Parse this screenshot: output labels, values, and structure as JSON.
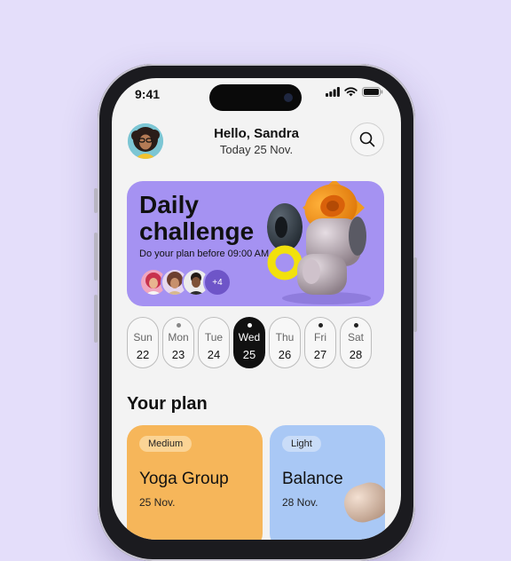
{
  "status_bar": {
    "time": "9:41"
  },
  "header": {
    "greeting": "Hello, Sandra",
    "date": "Today 25 Nov."
  },
  "challenge": {
    "title_line1": "Daily",
    "title_line2": "challenge",
    "subtitle": "Do your plan before 09:00 AM",
    "more_participants": "+4"
  },
  "days": [
    {
      "name": "Sun",
      "date": "22",
      "dot": false,
      "active": false
    },
    {
      "name": "Mon",
      "date": "23",
      "dot": "grey",
      "active": false
    },
    {
      "name": "Tue",
      "date": "24",
      "dot": false,
      "active": false
    },
    {
      "name": "Wed",
      "date": "25",
      "dot": true,
      "active": true
    },
    {
      "name": "Thu",
      "date": "26",
      "dot": false,
      "active": false
    },
    {
      "name": "Fri",
      "date": "27",
      "dot": true,
      "active": false
    },
    {
      "name": "Sat",
      "date": "28",
      "dot": true,
      "active": false
    }
  ],
  "plan": {
    "title": "Your plan",
    "cards": [
      {
        "tag": "Medium",
        "title": "Yoga Group",
        "date": "25 Nov."
      },
      {
        "tag": "Light",
        "title": "Balance",
        "date": "28 Nov."
      }
    ]
  },
  "colors": {
    "background": "#e4defa",
    "challenge_card": "#a592f2",
    "yoga_card": "#f6b65a",
    "balance_card": "#a9c8f5",
    "active_day": "#111111"
  }
}
